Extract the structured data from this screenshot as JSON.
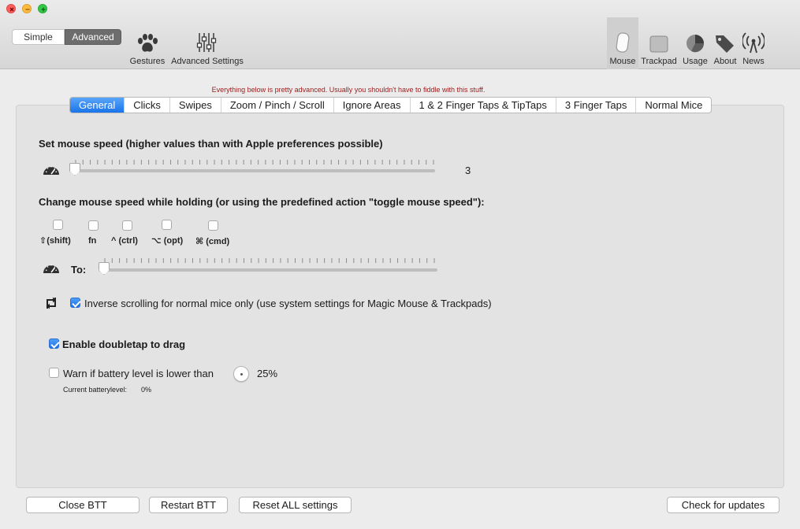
{
  "window": {
    "buttons": [
      "close",
      "minimize",
      "zoom"
    ]
  },
  "mode": {
    "simple_label": "Simple",
    "advanced_label": "Advanced",
    "selected": "Advanced"
  },
  "toolbar_left": [
    {
      "label": "Gestures",
      "icon": "paw-icon"
    },
    {
      "label": "Advanced Settings",
      "icon": "sliders-icon"
    }
  ],
  "toolbar_right": [
    {
      "label": "Mouse",
      "icon": "mouse-icon",
      "selected": true
    },
    {
      "label": "Trackpad",
      "icon": "trackpad-icon"
    },
    {
      "label": "Usage",
      "icon": "pie-chart-icon"
    },
    {
      "label": "About",
      "icon": "tags-icon"
    },
    {
      "label": "News",
      "icon": "antenna-icon"
    }
  ],
  "warning_note": "Everything below is pretty advanced. Usually you shouldn't have to fiddle with this stuff.",
  "tabs": [
    {
      "label": "General",
      "active": true
    },
    {
      "label": "Clicks"
    },
    {
      "label": "Swipes"
    },
    {
      "label": "Zoom / Pinch / Scroll"
    },
    {
      "label": "Ignore Areas"
    },
    {
      "label": "1 & 2 Finger Taps & TipTaps"
    },
    {
      "label": "3 Finger Taps"
    },
    {
      "label": "Normal Mice"
    }
  ],
  "general": {
    "mouse_speed_label": "Set mouse speed (higher values than with Apple preferences possible)",
    "mouse_speed_value": "3",
    "mouse_speed_fraction": 0.0,
    "hold_label": "Change mouse speed while holding (or using the predefined action \"toggle mouse speed\"):",
    "modifiers": [
      {
        "label": "⇧(shift)",
        "checked": false
      },
      {
        "label": "fn",
        "checked": false
      },
      {
        "label": "^ (ctrl)",
        "checked": false
      },
      {
        "label": "⌥ (opt)",
        "checked": false
      },
      {
        "label": "⌘ (cmd)",
        "checked": false
      }
    ],
    "to_label": "To:",
    "to_fraction": 0.0,
    "inverse_scroll_label": "Inverse scrolling for normal mice only (use system settings for Magic Mouse & Trackpads)",
    "inverse_scroll_checked": true,
    "doubletap_label": "Enable doubletap to drag",
    "doubletap_checked": true,
    "battery_warn_label": "Warn if battery level is lower than",
    "battery_warn_checked": false,
    "battery_threshold": "25%",
    "current_battery_label": "Current batterylevel:",
    "current_battery_value": "0%"
  },
  "footer": {
    "close": "Close BTT",
    "restart": "Restart BTT",
    "reset": "Reset ALL settings",
    "updates": "Check for updates"
  },
  "colors": {
    "accent": "#1a74ea",
    "warning": "#9b1a1a",
    "panel": "#e3e3e3"
  }
}
